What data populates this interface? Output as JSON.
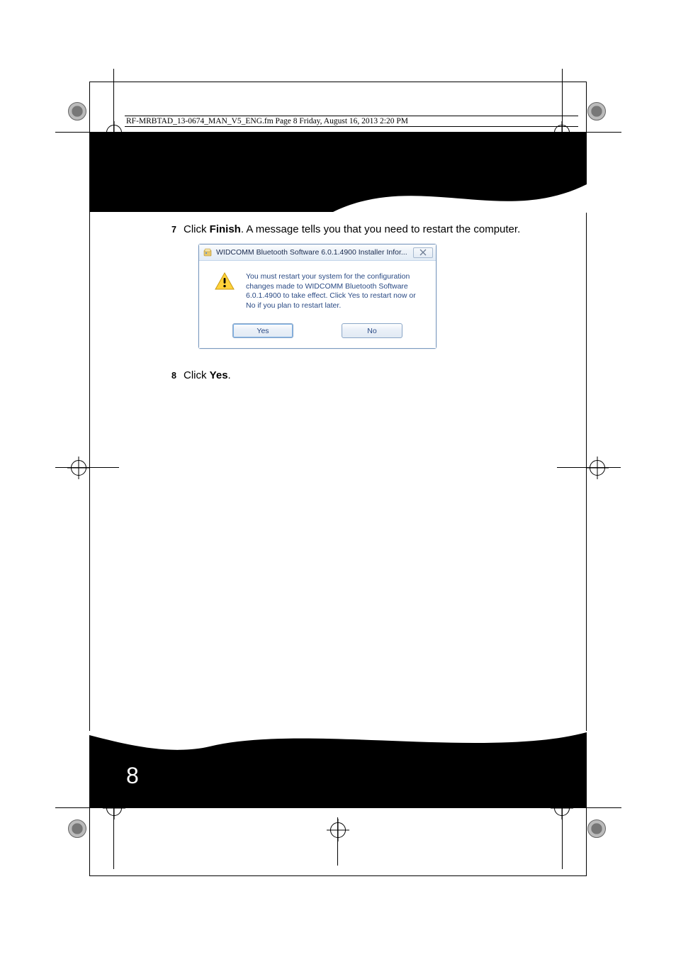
{
  "header_line": "RF-MRBTAD_13-0674_MAN_V5_ENG.fm  Page 8  Friday, August 16, 2013  2:20 PM",
  "steps": {
    "s7": {
      "num": "7",
      "pre": "Click ",
      "bold": "Finish",
      "post": ". A message tells you that you need to restart the computer."
    },
    "s8": {
      "num": "8",
      "pre": "Click ",
      "bold": "Yes",
      "post": "."
    }
  },
  "dialog": {
    "title": "WIDCOMM Bluetooth Software 6.0.1.4900 Installer Infor...",
    "message": "You must restart your system for the configuration changes made to WIDCOMM Bluetooth Software 6.0.1.4900 to take effect. Click Yes to restart now or No if you plan to restart later.",
    "yes": "Yes",
    "no": "No"
  },
  "page_number": "8"
}
